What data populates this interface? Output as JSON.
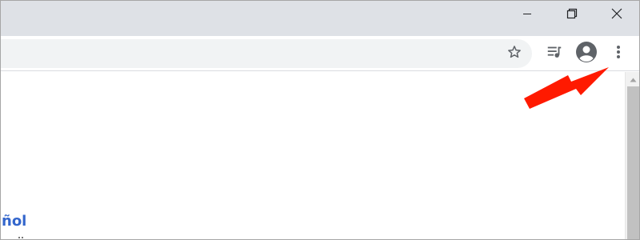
{
  "window": {
    "controls": [
      "minimize-icon",
      "restore-icon",
      "close-icon"
    ]
  },
  "toolbar": {
    "icons": [
      "star-icon",
      "media-queue-icon",
      "account-circle-icon",
      "kebab-menu-icon"
    ]
  },
  "content": {
    "language_link": "ñol"
  },
  "annotation": {
    "arrow_color": "#ff1a00"
  },
  "colors": {
    "titlebar": "#dee1e6",
    "omnibox": "#f1f3f4",
    "link": "#3366cc",
    "icon": "#5f6368"
  }
}
